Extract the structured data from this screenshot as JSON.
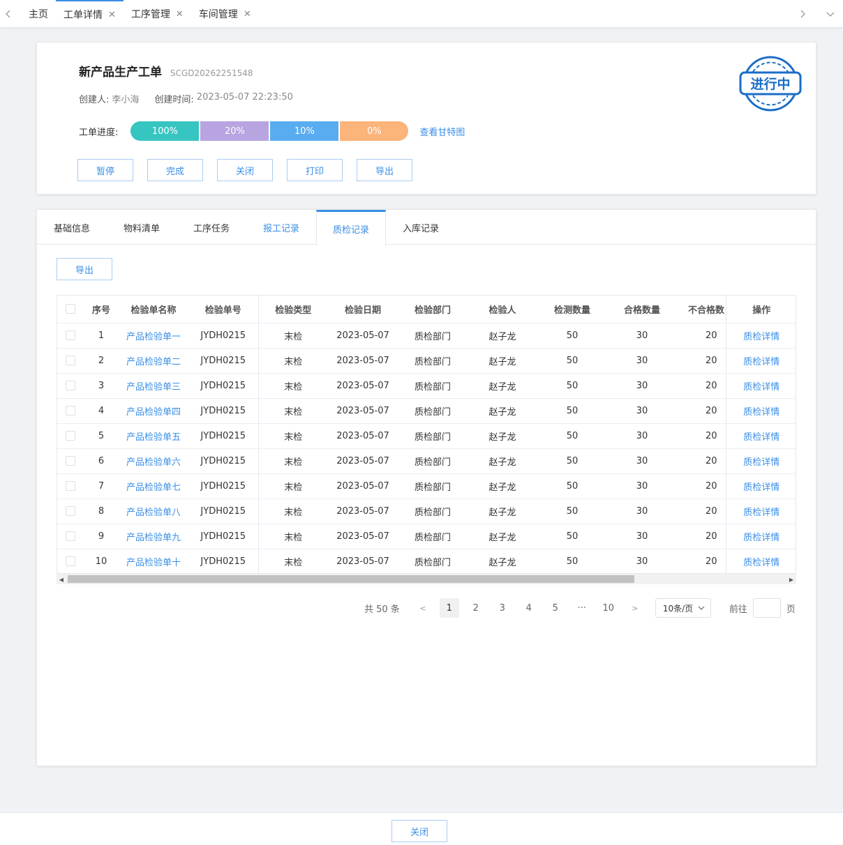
{
  "topbar": {
    "tabs": [
      {
        "label": "主页",
        "closable": false
      },
      {
        "label": "工单详情",
        "closable": true
      },
      {
        "label": "工序管理",
        "closable": true
      },
      {
        "label": "车间管理",
        "closable": true
      }
    ]
  },
  "header": {
    "title": "新产品生产工单",
    "code": "SCGD20262251548",
    "creator_label": "创建人:",
    "creator": "李小海",
    "created_label": "创建时间:",
    "created_at": "2023-05-07 22:23:50",
    "progress_label": "工单进度:",
    "progress": [
      {
        "label": "100%",
        "value": 100,
        "color": "#36c5c1"
      },
      {
        "label": "20%",
        "value": 20,
        "color": "#b7a4e0"
      },
      {
        "label": "10%",
        "value": 10,
        "color": "#5aacf0"
      },
      {
        "label": "0%",
        "value": 0,
        "color": "#fbb47a"
      }
    ],
    "gantt_link": "查看甘特图",
    "buttons": [
      "暂停",
      "完成",
      "关闭",
      "打印",
      "导出"
    ],
    "stamp": {
      "text": "进行中",
      "color": "#1a6dc8"
    }
  },
  "detail_tabs": [
    {
      "label": "基础信息",
      "state": "normal"
    },
    {
      "label": "物料清单",
      "state": "normal"
    },
    {
      "label": "工序任务",
      "state": "normal"
    },
    {
      "label": "报工记录",
      "state": "blue"
    },
    {
      "label": "质检记录",
      "state": "active"
    },
    {
      "label": "入库记录",
      "state": "normal"
    }
  ],
  "export_label": "导出",
  "table": {
    "columns": [
      "序号",
      "检验单名称",
      "检验单号",
      "检验类型",
      "检验日期",
      "检验部门",
      "检验人",
      "检测数量",
      "合格数量",
      "不合格数",
      "操作"
    ],
    "rows": [
      {
        "no": "1",
        "name": "产品检验单一",
        "code": "JYDH0215",
        "type": "末检",
        "date": "2023-05-07",
        "dept": "质检部门",
        "inspector": "赵子龙",
        "qty": "50",
        "pass": "30",
        "fail": "20",
        "op": "质检详情"
      },
      {
        "no": "2",
        "name": "产品检验单二",
        "code": "JYDH0215",
        "type": "末检",
        "date": "2023-05-07",
        "dept": "质检部门",
        "inspector": "赵子龙",
        "qty": "50",
        "pass": "30",
        "fail": "20",
        "op": "质检详情"
      },
      {
        "no": "3",
        "name": "产品检验单三",
        "code": "JYDH0215",
        "type": "末检",
        "date": "2023-05-07",
        "dept": "质检部门",
        "inspector": "赵子龙",
        "qty": "50",
        "pass": "30",
        "fail": "20",
        "op": "质检详情"
      },
      {
        "no": "4",
        "name": "产品检验单四",
        "code": "JYDH0215",
        "type": "末检",
        "date": "2023-05-07",
        "dept": "质检部门",
        "inspector": "赵子龙",
        "qty": "50",
        "pass": "30",
        "fail": "20",
        "op": "质检详情"
      },
      {
        "no": "5",
        "name": "产品检验单五",
        "code": "JYDH0215",
        "type": "末检",
        "date": "2023-05-07",
        "dept": "质检部门",
        "inspector": "赵子龙",
        "qty": "50",
        "pass": "30",
        "fail": "20",
        "op": "质检详情"
      },
      {
        "no": "6",
        "name": "产品检验单六",
        "code": "JYDH0215",
        "type": "末检",
        "date": "2023-05-07",
        "dept": "质检部门",
        "inspector": "赵子龙",
        "qty": "50",
        "pass": "30",
        "fail": "20",
        "op": "质检详情"
      },
      {
        "no": "7",
        "name": "产品检验单七",
        "code": "JYDH0215",
        "type": "末检",
        "date": "2023-05-07",
        "dept": "质检部门",
        "inspector": "赵子龙",
        "qty": "50",
        "pass": "30",
        "fail": "20",
        "op": "质检详情"
      },
      {
        "no": "8",
        "name": "产品检验单八",
        "code": "JYDH0215",
        "type": "末检",
        "date": "2023-05-07",
        "dept": "质检部门",
        "inspector": "赵子龙",
        "qty": "50",
        "pass": "30",
        "fail": "20",
        "op": "质检详情"
      },
      {
        "no": "9",
        "name": "产品检验单九",
        "code": "JYDH0215",
        "type": "末检",
        "date": "2023-05-07",
        "dept": "质检部门",
        "inspector": "赵子龙",
        "qty": "50",
        "pass": "30",
        "fail": "20",
        "op": "质检详情"
      },
      {
        "no": "10",
        "name": "产品检验单十",
        "code": "JYDH0215",
        "type": "末检",
        "date": "2023-05-07",
        "dept": "质检部门",
        "inspector": "赵子龙",
        "qty": "50",
        "pass": "30",
        "fail": "20",
        "op": "质检详情"
      }
    ]
  },
  "pagination": {
    "total": "共 50 条",
    "pages": [
      "1",
      "2",
      "3",
      "4",
      "5",
      "···",
      "10"
    ],
    "current": "1",
    "page_size": "10条/页",
    "goto_label": "前往",
    "page_suffix": "页"
  },
  "footer": {
    "close_label": "关闭"
  }
}
